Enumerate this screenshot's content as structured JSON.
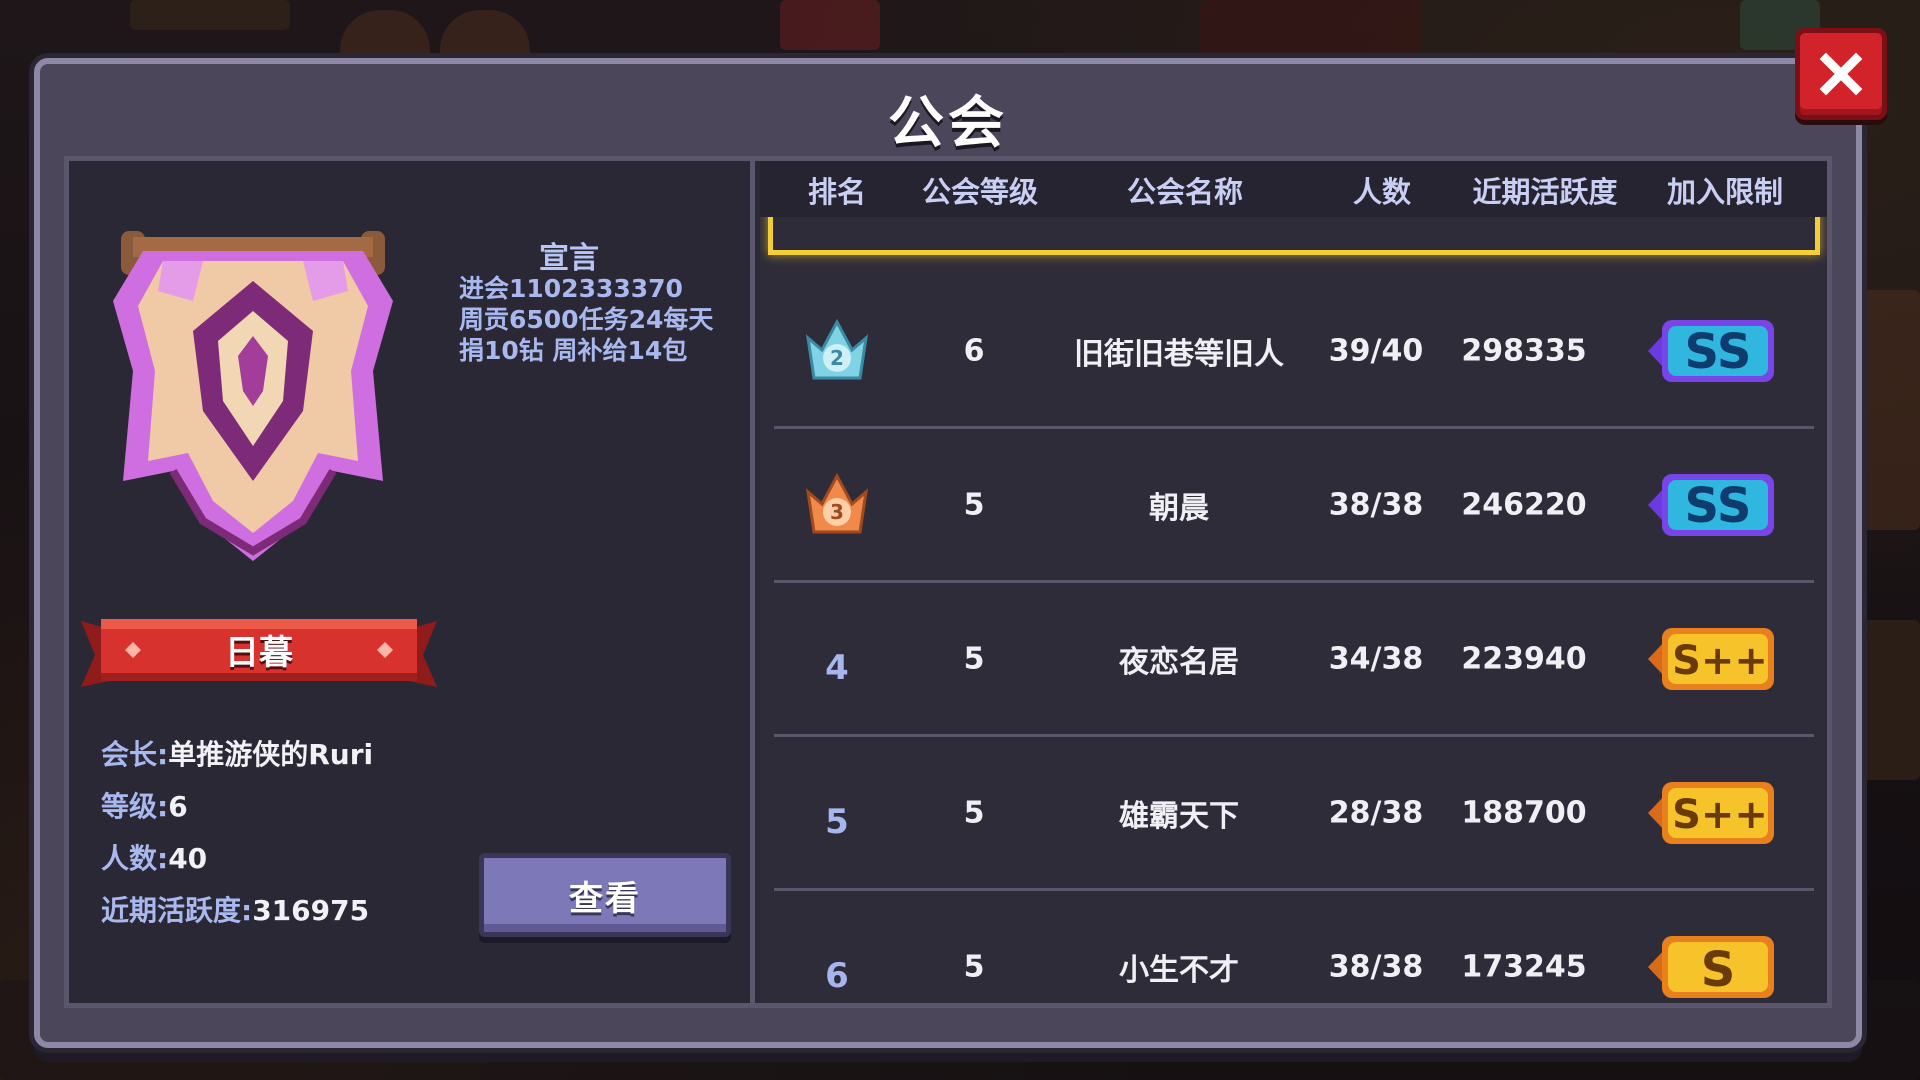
{
  "window": {
    "title": "公会"
  },
  "guild": {
    "name": "日暮",
    "declaration_title": "宣言",
    "declaration_lines": [
      "进会1102333370",
      "周贡6500任务24每天",
      "捐10钻 周补给14包"
    ],
    "leader_label": "会长:",
    "leader": "单推游侠的Ruri",
    "level_label": "等级:",
    "level": "6",
    "members_label": "人数:",
    "members": "40",
    "activity_label": "近期活跃度:",
    "activity": "316975",
    "view_button": "查看"
  },
  "table": {
    "headers": [
      "排名",
      "公会等级",
      "公会名称",
      "人数",
      "近期活跃度",
      "加入限制"
    ],
    "rows": [
      {
        "rank": "2",
        "rank_badge": "silver-crown-icon",
        "level": "6",
        "name": "旧街旧巷等旧人",
        "members": "39/40",
        "activity": "298335",
        "restriction": "SS"
      },
      {
        "rank": "3",
        "rank_badge": "bronze-crown-icon",
        "level": "5",
        "name": "朝晨",
        "members": "38/38",
        "activity": "246220",
        "restriction": "SS"
      },
      {
        "rank": "4",
        "level": "5",
        "name": "夜恋名居",
        "members": "34/38",
        "activity": "223940",
        "restriction": "S++"
      },
      {
        "rank": "5",
        "level": "5",
        "name": "雄霸天下",
        "members": "28/38",
        "activity": "188700",
        "restriction": "S++"
      },
      {
        "rank": "6",
        "level": "5",
        "name": "小生不才",
        "members": "38/38",
        "activity": "173245",
        "restriction": "S"
      }
    ]
  },
  "colors": {
    "highlight": "#f3cf35",
    "close": "#d3232a",
    "button": "#7d78b8",
    "ribbon": "#d8322f"
  }
}
